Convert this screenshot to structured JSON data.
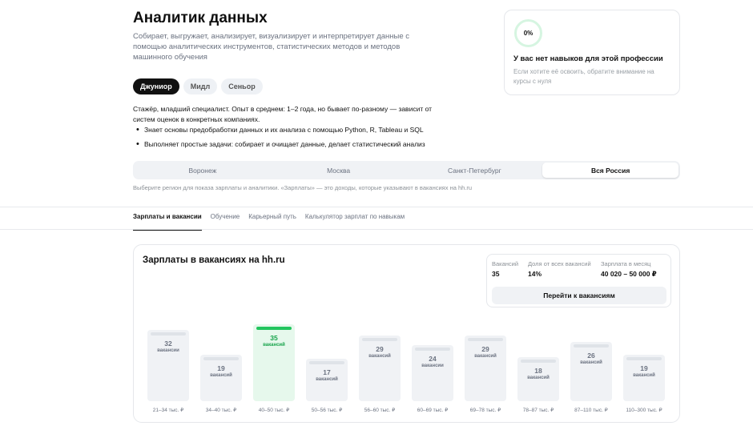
{
  "profession": {
    "title": "Аналитик данных",
    "description": "Собирает, выгружает, анализирует, визуализирует и интерпретирует данные с помощью аналитических инструментов, статистических методов и методов машинного обучения"
  },
  "levels": [
    {
      "label": "Джуниор",
      "active": true
    },
    {
      "label": "Мидл",
      "active": false
    },
    {
      "label": "Сеньор",
      "active": false
    }
  ],
  "level_description": "Стажёр, младший специалист. Опыт в среднем: 1–2 года, но бывает по-разному — зависит от систем оценок в конкретных компаниях.",
  "bullets": [
    "Знает основы предобработки данных и их анализа с помощью Python, R, Tableau и SQL",
    "Выполняет простые задачи: собирает и очищает данные, делает статистический анализ"
  ],
  "skills_card": {
    "percent": "0%",
    "progress": 0,
    "title": "У вас нет навыков для этой профессии",
    "note": "Если хотите её освоить, обратите внимание на курсы с нуля"
  },
  "regions": [
    {
      "label": "Воронеж",
      "active": false
    },
    {
      "label": "Москва",
      "active": false
    },
    {
      "label": "Санкт-Петербург",
      "active": false
    },
    {
      "label": "Вся Россия",
      "active": true
    }
  ],
  "region_hint": "Выберите регион для показа зарплаты и аналитики. «Зарплаты» — это доходы, которые указывают в вакансиях на hh.ru",
  "tabs": [
    {
      "label": "Зарплаты и вакансии",
      "active": true
    },
    {
      "label": "Обучение",
      "active": false
    },
    {
      "label": "Карьерный путь",
      "active": false
    },
    {
      "label": "Калькулятор зарплат по навыкам",
      "active": false
    }
  ],
  "salary_panel": {
    "title": "Зарплаты в вакансиях на hh.ru",
    "stats": {
      "vacancies_label": "Вакансий",
      "vacancies_value": "35",
      "share_label": "Доля от всех вакансий",
      "share_value": "14%",
      "salary_label": "Зарплата в месяц",
      "salary_value": "40 020 – 50 000 ₽"
    },
    "button_label": "Перейти к вакансиям",
    "unit_label": "вакансии",
    "unit_label_alt": "вакансий"
  },
  "chart_data": {
    "type": "bar",
    "categories": [
      "21–34 тыс. ₽",
      "34–40 тыс. ₽",
      "40–50 тыс. ₽",
      "50–56 тыс. ₽",
      "56–60 тыс. ₽",
      "60–69 тыс. ₽",
      "69–78 тыс. ₽",
      "78–87 тыс. ₽",
      "87–110 тыс. ₽",
      "110–300 тыс. ₽"
    ],
    "values": [
      32,
      19,
      35,
      17,
      29,
      24,
      29,
      18,
      26,
      19
    ],
    "units": [
      "вакансии",
      "вакансий",
      "вакансий",
      "вакансий",
      "вакансий",
      "вакансии",
      "вакансий",
      "вакансий",
      "вакансий",
      "вакансий"
    ],
    "highlight_index": 2,
    "highlight_color": "#22c55e",
    "bar_color": "#f0f2f5",
    "ylim": [
      0,
      35
    ]
  },
  "colors": {
    "accent": "#22c55e",
    "active_level_bg": "#111111"
  }
}
